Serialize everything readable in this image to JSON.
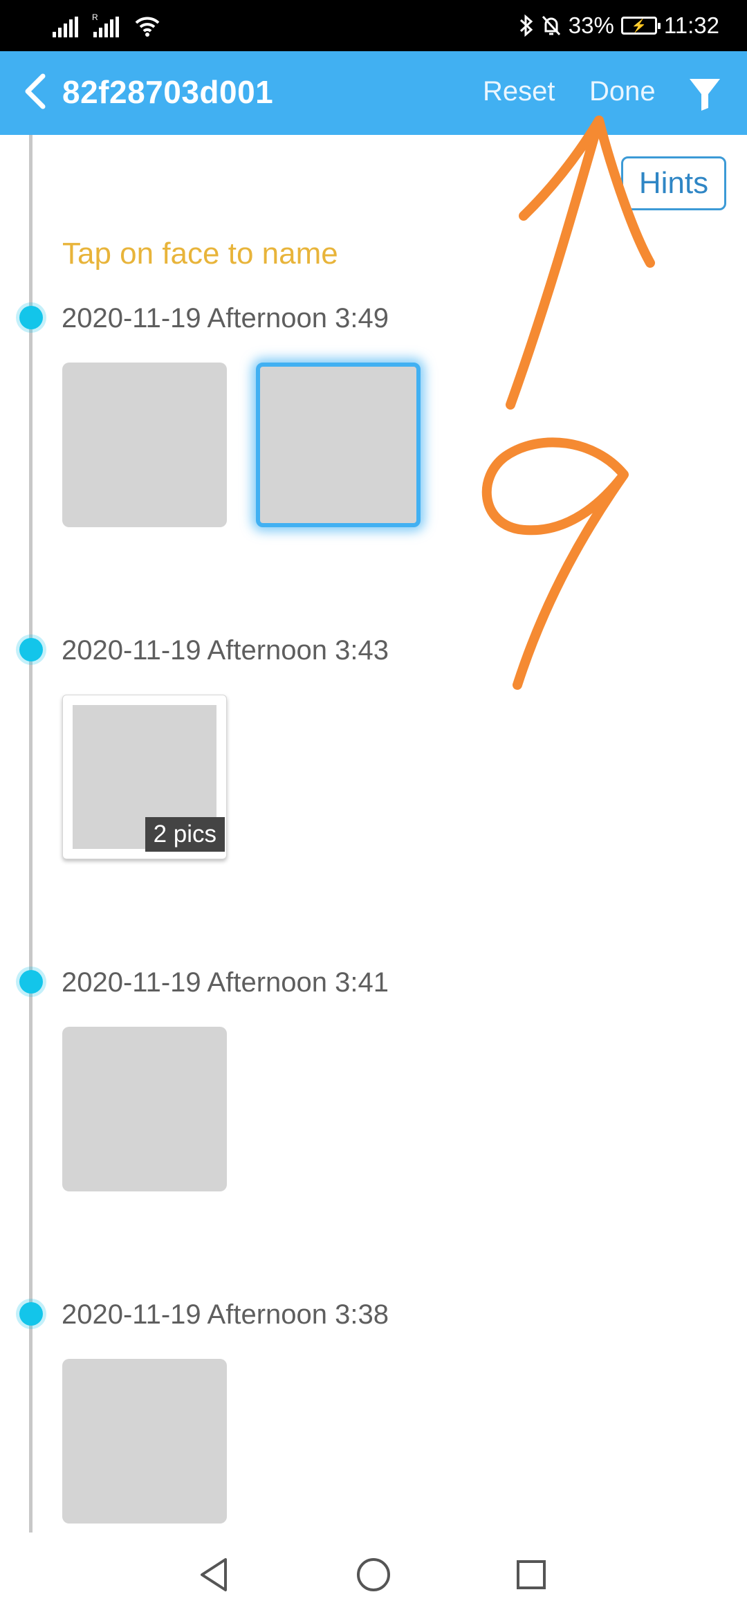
{
  "status_bar": {
    "battery": "33%",
    "time": "11:32"
  },
  "app_bar": {
    "title": "82f28703d001",
    "reset_label": "Reset",
    "done_label": "Done"
  },
  "hints_label": "Hints",
  "hint_text": "Tap on face to name",
  "groups": [
    {
      "timestamp": "2020-11-19 Afternoon 3:49",
      "thumbnails": 2,
      "selected_index": 1
    },
    {
      "timestamp": "2020-11-19 Afternoon 3:43",
      "thumbnails": 1,
      "badge": "2 pics"
    },
    {
      "timestamp": "2020-11-19 Afternoon 3:41",
      "thumbnails": 1
    },
    {
      "timestamp": "2020-11-19 Afternoon 3:38",
      "thumbnails": 1
    }
  ],
  "colors": {
    "app_bar": "#41b0f2",
    "timeline_dot": "#13c5ea",
    "hint_text": "#e8b43a",
    "annotation": "#f58a32"
  },
  "icons": {
    "back": "chevron-left-icon",
    "filter": "filter-funnel-icon",
    "nav_back": "triangle-back-icon",
    "nav_home": "circle-home-icon",
    "nav_recents": "square-recents-icon"
  }
}
